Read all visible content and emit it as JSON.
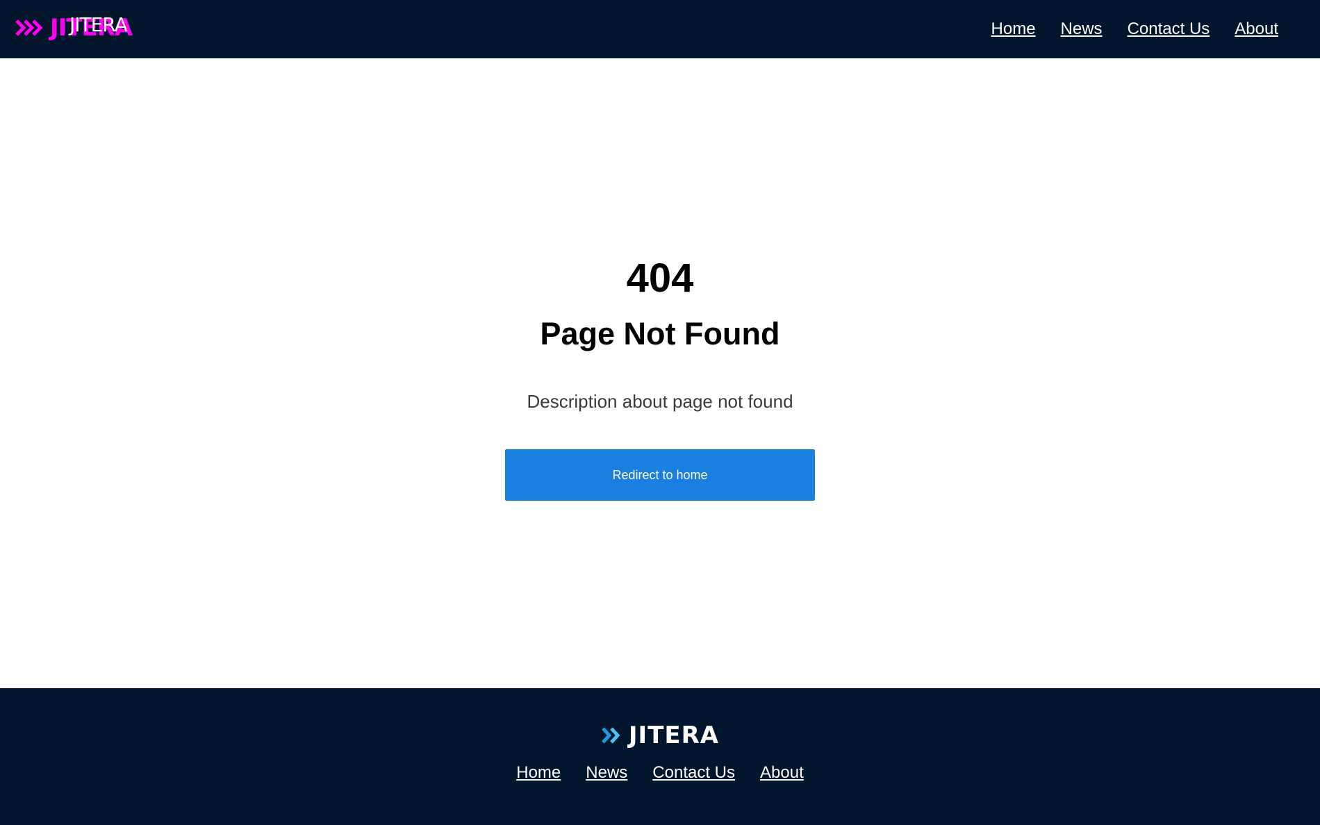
{
  "header": {
    "logo_text": "JITERA",
    "nav": [
      "Home",
      "News",
      "Contact Us",
      "About"
    ]
  },
  "main": {
    "code": "404",
    "title": "Page Not Found",
    "description": "Description about page not found",
    "button_label": "Redirect to home"
  },
  "footer": {
    "logo_text": "JITERA",
    "nav": [
      "Home",
      "News",
      "Contact Us",
      "About"
    ]
  },
  "colors": {
    "header_bg": "#01152d",
    "footer_bg": "#01152d",
    "button_bg": "#1a7fde",
    "header_logo_accent": "#ff00f0",
    "footer_logo_accent": "#1a9be0"
  }
}
